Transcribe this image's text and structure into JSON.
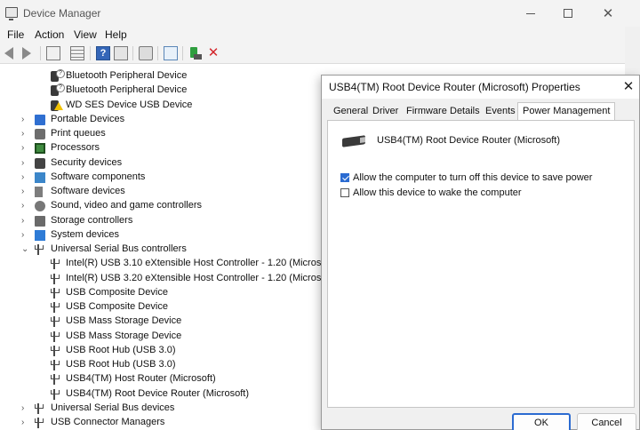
{
  "window": {
    "title": "Device Manager",
    "minimize_icon": "minimize-icon",
    "maximize_icon": "maximize-icon",
    "close_glyph": "✕"
  },
  "menu": {
    "file": "File",
    "action": "Action",
    "view": "View",
    "help": "Help"
  },
  "toolbar": {
    "help_glyph": "?",
    "remove_glyph": "✕"
  },
  "tree": {
    "items": [
      {
        "label": "Bluetooth Peripheral Device",
        "icon": "bluetooth-unknown-device-icon",
        "level": 2
      },
      {
        "label": "Bluetooth Peripheral Device",
        "icon": "bluetooth-unknown-device-icon",
        "level": 2
      },
      {
        "label": "WD SES Device USB Device",
        "icon": "warning-device-icon",
        "level": 2
      },
      {
        "label": "Portable Devices",
        "icon": "portable-device-icon",
        "level": 1,
        "expander": "›"
      },
      {
        "label": "Print queues",
        "icon": "printer-icon",
        "level": 1,
        "expander": "›"
      },
      {
        "label": "Processors",
        "icon": "processor-icon",
        "level": 1,
        "expander": "›"
      },
      {
        "label": "Security devices",
        "icon": "security-device-icon",
        "level": 1,
        "expander": "›"
      },
      {
        "label": "Software components",
        "icon": "software-component-icon",
        "level": 1,
        "expander": "›"
      },
      {
        "label": "Software devices",
        "icon": "software-device-icon",
        "level": 1,
        "expander": "›"
      },
      {
        "label": "Sound, video and game controllers",
        "icon": "sound-icon",
        "level": 1,
        "expander": "›"
      },
      {
        "label": "Storage controllers",
        "icon": "storage-controller-icon",
        "level": 1,
        "expander": "›"
      },
      {
        "label": "System devices",
        "icon": "system-device-icon",
        "level": 1,
        "expander": "›"
      },
      {
        "label": "Universal Serial Bus controllers",
        "icon": "usb-icon",
        "level": 1,
        "expander": "⌄"
      },
      {
        "label": "Intel(R) USB 3.10 eXtensible Host Controller - 1.20 (Microsoft)",
        "icon": "usb-icon",
        "level": 2
      },
      {
        "label": "Intel(R) USB 3.20 eXtensible Host Controller - 1.20 (Microsoft)",
        "icon": "usb-icon",
        "level": 2
      },
      {
        "label": "USB Composite Device",
        "icon": "usb-icon",
        "level": 2
      },
      {
        "label": "USB Composite Device",
        "icon": "usb-icon",
        "level": 2
      },
      {
        "label": "USB Mass Storage Device",
        "icon": "usb-icon",
        "level": 2
      },
      {
        "label": "USB Mass Storage Device",
        "icon": "usb-icon",
        "level": 2
      },
      {
        "label": "USB Root Hub (USB 3.0)",
        "icon": "usb-icon",
        "level": 2
      },
      {
        "label": "USB Root Hub (USB 3.0)",
        "icon": "usb-icon",
        "level": 2
      },
      {
        "label": "USB4(TM) Host Router (Microsoft)",
        "icon": "usb-icon",
        "level": 2
      },
      {
        "label": "USB4(TM) Root Device Router (Microsoft)",
        "icon": "usb-icon",
        "level": 2
      },
      {
        "label": "Universal Serial Bus devices",
        "icon": "usb-icon",
        "level": 1,
        "expander": "›"
      },
      {
        "label": "USB Connector Managers",
        "icon": "usb-icon",
        "level": 1,
        "expander": "›"
      }
    ]
  },
  "dialog": {
    "title": "USB4(TM) Root Device Router (Microsoft) Properties",
    "close_glyph": "✕",
    "tabs": {
      "general": "General",
      "driver": "Driver",
      "firmware": "Firmware",
      "details": "Details",
      "events": "Events",
      "power": "Power Management"
    },
    "device_name": "USB4(TM) Root Device Router (Microsoft)",
    "options": {
      "allow_turn_off": {
        "label": "Allow the computer to turn off this device to save power",
        "checked": true
      },
      "allow_wake": {
        "label": "Allow this device to wake the computer",
        "checked": false
      }
    },
    "buttons": {
      "ok": "OK",
      "cancel": "Cancel"
    }
  },
  "colors": {
    "accent": "#2b6bd1",
    "remove_red": "#d3262b",
    "warning_yellow": "#f2c200"
  }
}
